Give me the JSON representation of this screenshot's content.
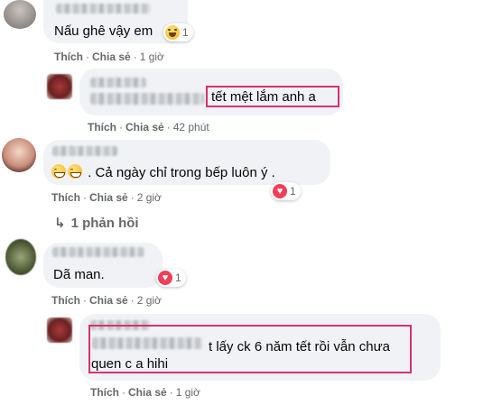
{
  "comments": [
    {
      "text": "Nấu ghê vậy em",
      "reaction_count": "1",
      "actions": {
        "like": "Thích",
        "share": "Chia sẻ",
        "time": "1 giờ"
      }
    },
    {
      "text": "tết mệt lắm anh a",
      "actions": {
        "like": "Thích",
        "share": "Chia sẻ",
        "time": "42 phút"
      }
    },
    {
      "text": ". Cả ngày chỉ trong bếp luôn ý .",
      "reaction_count": "1",
      "actions": {
        "like": "Thích",
        "share": "Chia sẻ",
        "time": "2 giờ"
      },
      "replies_label": "1 phản hồi"
    },
    {
      "text": "Dã man.",
      "reaction_count": "1",
      "actions": {
        "like": "Thích",
        "share": "Chia sẻ",
        "time": "2 giờ"
      }
    },
    {
      "text_line1": "t lấy ck 6 năm tết rồi vẫn chưa",
      "text_line2": "quen c a hihi",
      "actions": {
        "like": "Thích",
        "share": "Chia sẻ",
        "time": "1 giờ"
      }
    }
  ],
  "separator": "·",
  "colors": {
    "bubble": "#f0f2f5",
    "highlight_box": "#d6336c",
    "secondary_text": "#65676b",
    "love_reaction": "#f33e58"
  },
  "icons": [
    "haha-reaction-icon",
    "love-reaction-icon",
    "grinning-emoji-icon",
    "reply-arrow-icon"
  ]
}
